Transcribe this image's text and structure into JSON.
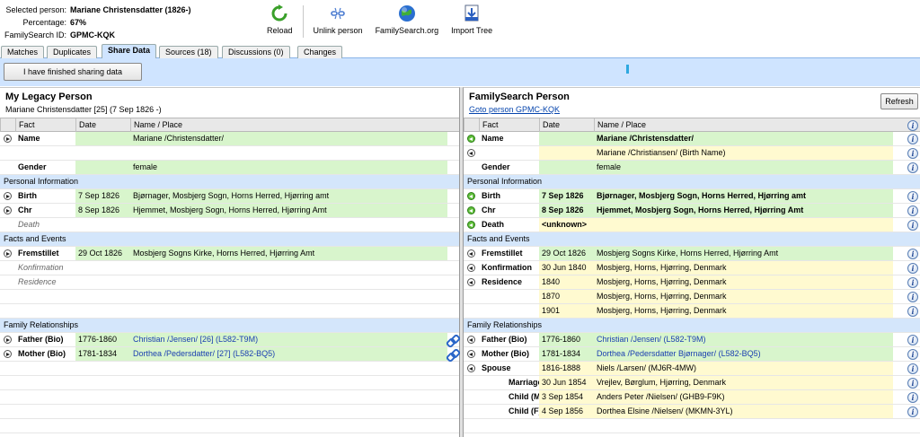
{
  "header": {
    "selected_label": "Selected person:",
    "selected_value": "Mariane Christensdatter (1826-)",
    "percentage_label": "Percentage:",
    "percentage_value": "67%",
    "fsid_label": "FamilySearch ID:",
    "fsid_value": "GPMC-KQK"
  },
  "toolbar": {
    "reload": "Reload",
    "unlink": "Unlink person",
    "familysearch": "FamilySearch.org",
    "import": "Import Tree"
  },
  "tabs": [
    "Matches",
    "Duplicates",
    "Share Data",
    "Sources (18)",
    "Discussions (0)",
    "Changes"
  ],
  "active_tab": "Share Data",
  "band": {
    "finish_button": "I have finished sharing data"
  },
  "columns": {
    "fact": "Fact",
    "date": "Date",
    "place": "Name / Place"
  },
  "left": {
    "title": "My Legacy Person",
    "subtitle": "Mariane Christensdatter [25] (7 Sep 1826 -)",
    "rows": [
      {
        "kind": "data",
        "exp": "fwd",
        "fact": "Name",
        "fstyle": "bold",
        "date": "",
        "place": "Mariane /Christensdatter/",
        "bg": "g",
        "pstyle": ""
      },
      {
        "kind": "data",
        "exp": "",
        "fact": "",
        "fstyle": "",
        "date": "",
        "place": "",
        "bg": "",
        "pstyle": ""
      },
      {
        "kind": "data",
        "exp": "",
        "fact": "Gender",
        "fstyle": "bold",
        "date": "",
        "place": "female",
        "bg": "g",
        "pstyle": ""
      },
      {
        "kind": "sec",
        "label": "Personal Information"
      },
      {
        "kind": "data",
        "exp": "fwd",
        "fact": "Birth",
        "fstyle": "bold",
        "date": "7 Sep 1826",
        "place": "Bjørnager, Mosbjerg Sogn, Horns Herred, Hjørring amt",
        "bg": "g",
        "pstyle": ""
      },
      {
        "kind": "data",
        "exp": "fwd",
        "fact": "Chr",
        "fstyle": "bold",
        "date": "8 Sep 1826",
        "place": "Hjemmet, Mosbjerg Sogn, Horns Herred, Hjørring Amt",
        "bg": "g",
        "pstyle": ""
      },
      {
        "kind": "data",
        "exp": "",
        "fact": "Death",
        "fstyle": "ital",
        "date": "",
        "place": "",
        "bg": "",
        "pstyle": ""
      },
      {
        "kind": "sec",
        "label": "Facts and Events"
      },
      {
        "kind": "data",
        "exp": "fwd",
        "fact": "Fremstillet",
        "fstyle": "bold",
        "date": "29 Oct 1826",
        "place": "Mosbjerg Sogns Kirke, Horns Herred, Hjørring Amt",
        "bg": "g",
        "pstyle": ""
      },
      {
        "kind": "data",
        "exp": "",
        "fact": "Konfirmation",
        "fstyle": "ital",
        "date": "",
        "place": "",
        "bg": "",
        "pstyle": ""
      },
      {
        "kind": "data",
        "exp": "",
        "fact": "Residence",
        "fstyle": "ital",
        "date": "",
        "place": "",
        "bg": "",
        "pstyle": ""
      },
      {
        "kind": "data",
        "exp": "",
        "fact": "",
        "fstyle": "",
        "date": "",
        "place": "",
        "bg": "",
        "pstyle": ""
      },
      {
        "kind": "data",
        "exp": "",
        "fact": "",
        "fstyle": "",
        "date": "",
        "place": "",
        "bg": "",
        "pstyle": ""
      },
      {
        "kind": "sec",
        "label": "Family Relationships"
      },
      {
        "kind": "data",
        "exp": "fwd",
        "fact": "Father (Bio)",
        "fstyle": "bold",
        "date": "1776-1860",
        "place": "Christian /Jensen/ [26] (L582-T9M)",
        "bg": "g",
        "pstyle": "blue",
        "end": "link"
      },
      {
        "kind": "data",
        "exp": "fwd",
        "fact": "Mother (Bio)",
        "fstyle": "bold",
        "date": "1781-1834",
        "place": "Dorthea /Pedersdatter/ [27] (L582-BQ5)",
        "bg": "g",
        "pstyle": "blue",
        "end": "link"
      },
      {
        "kind": "data",
        "exp": "",
        "fact": "",
        "fstyle": "",
        "date": "",
        "place": "",
        "bg": "",
        "pstyle": ""
      },
      {
        "kind": "data",
        "exp": "",
        "fact": "",
        "fstyle": "",
        "date": "",
        "place": "",
        "bg": "",
        "pstyle": ""
      },
      {
        "kind": "data",
        "exp": "",
        "fact": "",
        "fstyle": "",
        "date": "",
        "place": "",
        "bg": "",
        "pstyle": ""
      },
      {
        "kind": "data",
        "exp": "",
        "fact": "",
        "fstyle": "",
        "date": "",
        "place": "",
        "bg": "",
        "pstyle": ""
      },
      {
        "kind": "data",
        "exp": "",
        "fact": "",
        "fstyle": "",
        "date": "",
        "place": "",
        "bg": "",
        "pstyle": ""
      }
    ]
  },
  "right": {
    "title": "FamilySearch Person",
    "subtitle": "Goto person GPMC-KQK",
    "refresh_button": "Refresh",
    "rows": [
      {
        "kind": "data",
        "exp": "green",
        "fact": "Name",
        "fstyle": "bold",
        "date": "",
        "place": "Mariane /Christensdatter/",
        "bg": "g",
        "pstyle": "bold",
        "end": "info"
      },
      {
        "kind": "data",
        "exp": "back",
        "fact": "",
        "fstyle": "",
        "date": "",
        "place": "Mariane /Christiansen/ (Birth Name)",
        "bg": "y",
        "pstyle": "",
        "end": "info"
      },
      {
        "kind": "data",
        "exp": "",
        "fact": "Gender",
        "fstyle": "bold",
        "date": "",
        "place": "female",
        "bg": "g",
        "pstyle": "",
        "end": "info"
      },
      {
        "kind": "sec",
        "label": "Personal Information"
      },
      {
        "kind": "data",
        "exp": "green",
        "fact": "Birth",
        "fstyle": "bold",
        "date": "7 Sep 1826",
        "dstyle": "bold",
        "place": "Bjørnager, Mosbjerg Sogn, Horns Herred, Hjørring amt",
        "bg": "g",
        "pstyle": "bold",
        "end": "info"
      },
      {
        "kind": "data",
        "exp": "green",
        "fact": "Chr",
        "fstyle": "bold",
        "date": "8 Sep 1826",
        "dstyle": "bold",
        "place": "Hjemmet, Mosbjerg Sogn, Horns Herred, Hjørring Amt",
        "bg": "g",
        "pstyle": "bold",
        "end": "info"
      },
      {
        "kind": "data",
        "exp": "green",
        "fact": "Death",
        "fstyle": "bold",
        "date": "<unknown>",
        "dstyle": "bold",
        "place": "",
        "bg": "y",
        "pstyle": "",
        "end": "info"
      },
      {
        "kind": "sec",
        "label": "Facts and Events"
      },
      {
        "kind": "data",
        "exp": "back",
        "fact": "Fremstillet",
        "fstyle": "bold",
        "date": "29 Oct 1826",
        "place": "Mosbjerg Sogns Kirke, Horns Herred, Hjørring Amt",
        "bg": "g",
        "pstyle": "",
        "end": "info"
      },
      {
        "kind": "data",
        "exp": "back",
        "fact": "Konfirmation",
        "fstyle": "bold",
        "date": "30 Jun 1840",
        "place": "Mosbjerg, Horns, Hjørring, Denmark",
        "bg": "y",
        "pstyle": "",
        "end": "info"
      },
      {
        "kind": "data",
        "exp": "back",
        "fact": "Residence",
        "fstyle": "bold",
        "date": "1840",
        "place": "Mosbjerg, Horns, Hjørring, Denmark",
        "bg": "y",
        "pstyle": "",
        "end": "info"
      },
      {
        "kind": "data",
        "exp": "",
        "fact": "",
        "fstyle": "",
        "date": "1870",
        "place": "Mosbjerg, Horns, Hjørring, Denmark",
        "bg": "y",
        "pstyle": "",
        "end": "info"
      },
      {
        "kind": "data",
        "exp": "",
        "fact": "",
        "fstyle": "",
        "date": "1901",
        "place": "Mosbjerg, Horns, Hjørring, Denmark",
        "bg": "y",
        "pstyle": "",
        "end": "info"
      },
      {
        "kind": "sec",
        "label": "Family Relationships"
      },
      {
        "kind": "data",
        "exp": "back",
        "fact": "Father (Bio)",
        "fstyle": "bold",
        "date": "1776-1860",
        "place": "Christian /Jensen/ (L582-T9M)",
        "bg": "g",
        "pstyle": "blue",
        "end": "info"
      },
      {
        "kind": "data",
        "exp": "back",
        "fact": "Mother (Bio)",
        "fstyle": "bold",
        "date": "1781-1834",
        "place": "Dorthea /Pedersdatter Bjørnager/ (L582-BQ5)",
        "bg": "g",
        "pstyle": "blue",
        "end": "info"
      },
      {
        "kind": "data",
        "exp": "back",
        "fact": "Spouse",
        "fstyle": "bold",
        "date": "1816-1888",
        "place": "Niels /Larsen/ (MJ6R-4MW)",
        "bg": "y",
        "pstyle": "",
        "end": "info"
      },
      {
        "kind": "data",
        "exp": "",
        "fact": "Marriage",
        "fstyle": "bold",
        "indent": true,
        "date": "30 Jun 1854",
        "place": "Vrejlev, Børglum, Hjørring, Denmark",
        "bg": "y",
        "pstyle": "",
        "end": "info"
      },
      {
        "kind": "data",
        "exp": "",
        "fact": "Child (M)",
        "fstyle": "bold",
        "indent": true,
        "date": "3 Sep 1854",
        "place": "Anders Peter /Nielsen/ (GHB9-F9K)",
        "bg": "y",
        "pstyle": "",
        "end": "info"
      },
      {
        "kind": "data",
        "exp": "",
        "fact": "Child (F)",
        "fstyle": "bold",
        "indent": true,
        "date": "4 Sep 1856",
        "place": "Dorthea Elsine /Nielsen/ (MKMN-3YL)",
        "bg": "y",
        "pstyle": "",
        "end": "info"
      },
      {
        "kind": "data",
        "exp": "",
        "fact": "",
        "fstyle": "",
        "date": "",
        "place": "",
        "bg": "",
        "pstyle": ""
      }
    ]
  }
}
